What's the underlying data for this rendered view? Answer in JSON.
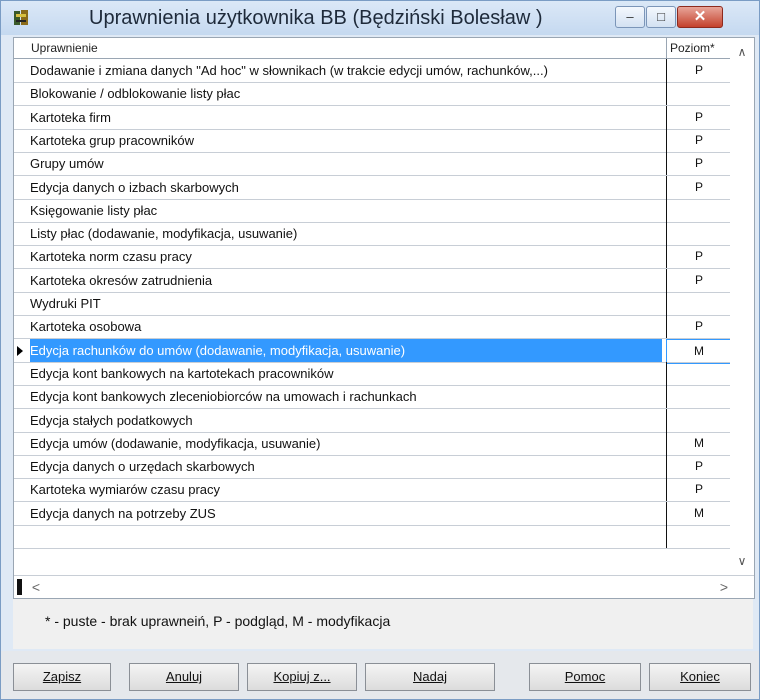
{
  "window": {
    "title": "Uprawnienia użytkownika BB (Będziński Bolesław )"
  },
  "titlebar": {
    "minimize_glyph": "–",
    "maximize_glyph": "□",
    "close_glyph": "✕"
  },
  "grid": {
    "columns": {
      "permission": "Uprawnienie",
      "level": "Poziom*"
    },
    "selected_index": 13,
    "rows": [
      {
        "permission": "Dodawanie i zmiana danych \"Ad hoc\"  w słownikach (w trakcie edycji umów, rachunków,...)",
        "level": "P"
      },
      {
        "permission": "Blokowanie / odblokowanie listy płac",
        "level": ""
      },
      {
        "permission": "Kartoteka firm",
        "level": "P"
      },
      {
        "permission": "Kartoteka grup pracowników",
        "level": "P"
      },
      {
        "permission": "Grupy umów",
        "level": "P"
      },
      {
        "permission": "Edycja danych o izbach skarbowych",
        "level": "P"
      },
      {
        "permission": "Księgowanie listy płac",
        "level": ""
      },
      {
        "permission": "Listy płac (dodawanie, modyfikacja, usuwanie)",
        "level": ""
      },
      {
        "permission": "Kartoteka norm czasu pracy",
        "level": "P"
      },
      {
        "permission": "Kartoteka okresów zatrudnienia",
        "level": "P"
      },
      {
        "permission": "Wydruki PIT",
        "level": ""
      },
      {
        "permission": "Kartoteka osobowa",
        "level": "P"
      },
      {
        "permission": "Edycja rachunków do umów  (dodawanie, modyfikacja, usuwanie)",
        "level": "M"
      },
      {
        "permission": "Edycja kont bankowych na kartotekach pracowników",
        "level": ""
      },
      {
        "permission": "Edycja kont bankowych zleceniobiorców na umowach i rachunkach",
        "level": ""
      },
      {
        "permission": "Edycja stałych podatkowych",
        "level": ""
      },
      {
        "permission": "Edycja umów (dodawanie, modyfikacja, usuwanie)",
        "level": "M"
      },
      {
        "permission": "Edycja danych o urzędach skarbowych",
        "level": "P"
      },
      {
        "permission": "Kartoteka wymiarów czasu pracy",
        "level": "P"
      },
      {
        "permission": "Edycja danych na potrzeby ZUS",
        "level": "M"
      },
      {
        "permission": "",
        "level": ""
      }
    ]
  },
  "scroll": {
    "up": "∧",
    "down": "∨",
    "left": "<",
    "right": ">"
  },
  "legend": "* - puste - brak uprawneiń, P - podgląd, M - modyfikacja",
  "buttons": {
    "save": "Zapisz",
    "cancel": "Anuluj",
    "copy": "Kopiuj z...",
    "grant": "Nadaj",
    "help": "Pomoc",
    "close": "Koniec"
  },
  "colors": {
    "selection": "#3399ff",
    "close_button": "#c4412c"
  }
}
